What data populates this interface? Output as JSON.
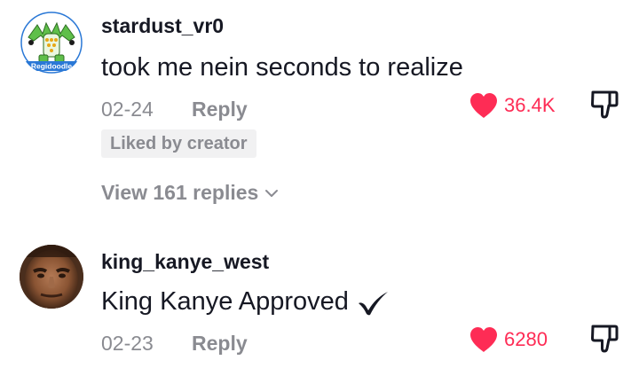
{
  "comments": [
    {
      "username": "stardust_vr0",
      "avatar_label": "Regidoodle",
      "text": "took me nein seconds to realize",
      "date": "02-24",
      "reply_label": "Reply",
      "likes": "36.4K",
      "liked_by_creator": "Liked by creator",
      "view_replies": "View 161 replies"
    },
    {
      "username": "king_kanye_west",
      "text": "King Kanye Approved",
      "date": "02-23",
      "reply_label": "Reply",
      "likes": "6280"
    }
  ],
  "colors": {
    "like": "#fe2c55",
    "muted": "#8a8b91",
    "text": "#161823"
  },
  "icons": {
    "like": "heart-icon",
    "dislike": "thumbs-down-icon",
    "expand": "chevron-down-icon",
    "approved": "checkmark-icon"
  }
}
